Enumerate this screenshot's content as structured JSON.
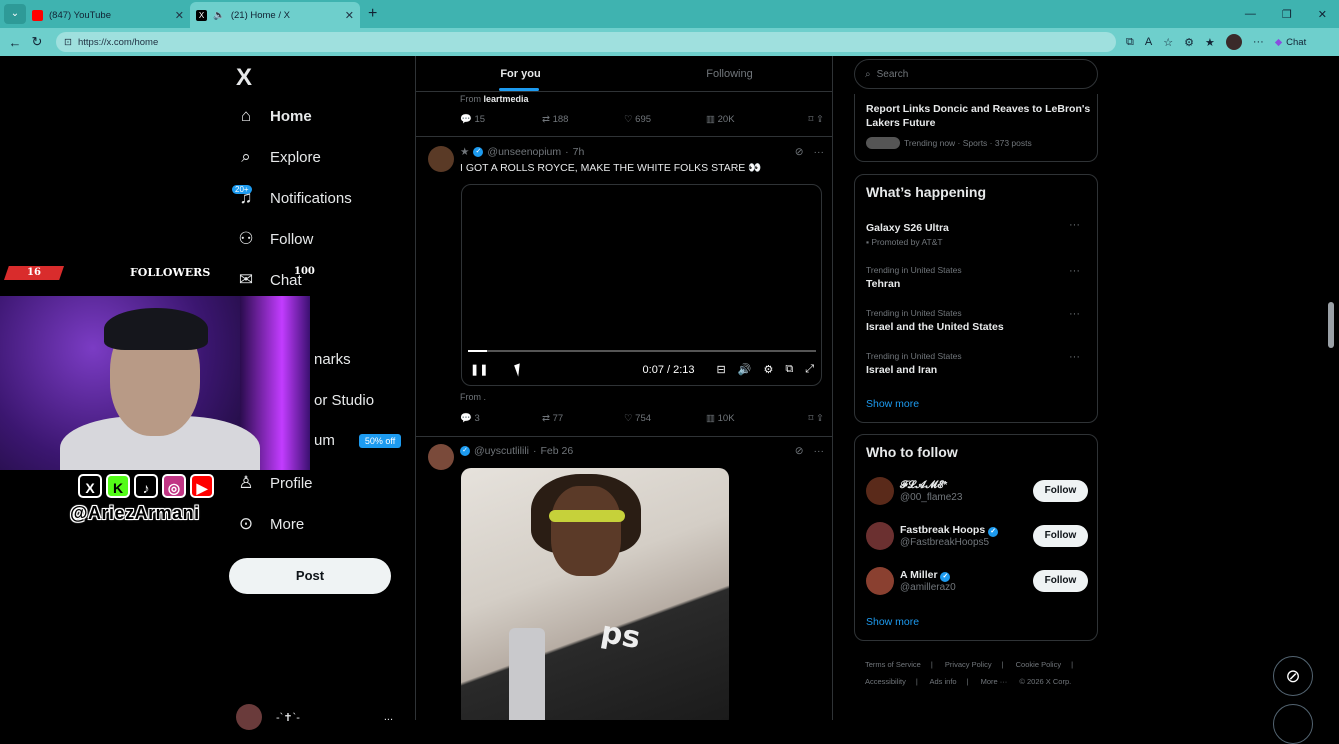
{
  "browser": {
    "tabs": [
      {
        "title": "(847) YouTube",
        "color": "#ff0000"
      },
      {
        "title": "(21) Home / X",
        "color": "#000000"
      }
    ],
    "url": "https://x.com/home",
    "copilot_label": "Chat"
  },
  "leftnav": {
    "logo": "X",
    "items": [
      {
        "label": "Home",
        "icon": "home-icon"
      },
      {
        "label": "Explore",
        "icon": "search-icon"
      },
      {
        "label": "Notifications",
        "icon": "bell-icon",
        "badge": "20+"
      },
      {
        "label": "Follow",
        "icon": "add-person-icon"
      },
      {
        "label": "Chat",
        "icon": "mail-icon"
      },
      {
        "label": "narks",
        "icon": "bookmark-icon"
      },
      {
        "label": "or Studio",
        "icon": "studio-icon"
      },
      {
        "label": "um",
        "icon": "premium-icon",
        "badge": "50% off"
      },
      {
        "label": "Profile",
        "icon": "person-icon"
      },
      {
        "label": "More",
        "icon": "more-icon"
      }
    ],
    "post_label": "Post",
    "bottom_name": "-`✝`-",
    "bottom_more": "..."
  },
  "feed": {
    "tabs": [
      "For you",
      "Following"
    ],
    "tweet1": {
      "from_prefix": "From",
      "from_source": "leartmedia",
      "replies": "15",
      "reposts": "188",
      "likes": "695",
      "views": "20K"
    },
    "tweet2": {
      "star": "★",
      "handle": "@unseenopium",
      "time": "7h",
      "text": "I GOT A ROLLS ROYCE, MAKE THE WHITE FOLKS STARE 👀",
      "video_time": "0:07 / 2:13",
      "video_progress": 0.054,
      "from_small": "From .",
      "replies": "3",
      "reposts": "77",
      "likes": "754",
      "views": "10K"
    },
    "tweet3": {
      "handle": "@uyscutlilili",
      "time": "Feb 26",
      "photo_text": "ps"
    }
  },
  "right": {
    "search_placeholder": "Search",
    "top_trend": {
      "name": "Report Links Doncic and Reaves to LeBron's Lakers Future",
      "meta": "Trending now · Sports · 373 posts"
    },
    "happening_title": "What’s happening",
    "trends": [
      {
        "context": "",
        "name": "Galaxy S26 Ultra",
        "promo": "Promoted by AT&T"
      },
      {
        "context": "Trending in United States",
        "name": "Tehran",
        "promo": ""
      },
      {
        "context": "Trending in United States",
        "name": "Israel and the United States",
        "promo": ""
      },
      {
        "context": "Trending in United States",
        "name": "Israel and Iran",
        "promo": ""
      }
    ],
    "show_more": "Show more",
    "who_title": "Who to follow",
    "follow": [
      {
        "name": "𝓕𝓛𝓐𝓜𝓔*",
        "handle": "@00_flame23",
        "verified": false
      },
      {
        "name": "Fastbreak Hoops",
        "handle": "@FastbreakHoops5",
        "verified": true
      },
      {
        "name": "A Miller",
        "handle": "@amilleraz0",
        "verified": true
      }
    ],
    "follow_label": "Follow",
    "footer": [
      "Terms of Service",
      "|",
      "Privacy Policy",
      "|",
      "Cookie Policy",
      "|",
      "Accessibility",
      "|",
      "Ads info",
      "|",
      "More ···",
      "© 2026 X Corp."
    ]
  },
  "overlay": {
    "followers_count": "16",
    "followers_label": "FOLLOWERS",
    "followers_goal": "100",
    "handle": "@AriezArmani",
    "social": [
      "X",
      "K",
      "♪",
      "◎",
      "▶"
    ]
  }
}
